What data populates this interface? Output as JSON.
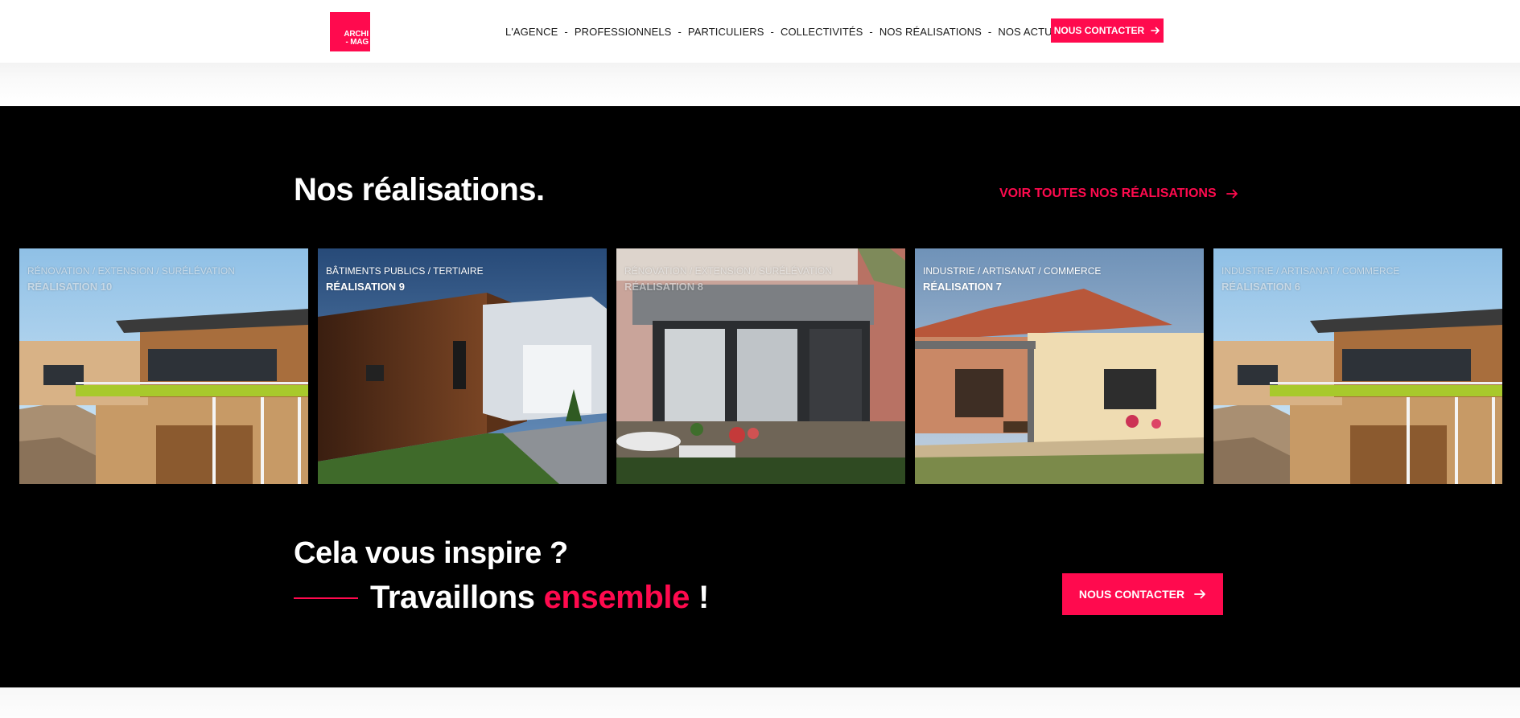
{
  "header": {
    "logo_lines": [
      "ARCHI",
      "- MAG"
    ],
    "nav": [
      {
        "label": "L'AGENCE"
      },
      {
        "label": "PROFESSIONNELS"
      },
      {
        "label": "PARTICULIERS"
      },
      {
        "label": "COLLECTIVITÉS"
      },
      {
        "label": "NOS RÉALISATIONS"
      },
      {
        "label": "NOS ACTUALITÉS"
      }
    ],
    "separator": "-",
    "cta_label": "NOUS CONTACTER",
    "cta_icon": "arrow-right-icon"
  },
  "section": {
    "title": "Nos réalisations.",
    "see_all_label": "VOIR TOUTES NOS RÉALISATIONS",
    "see_all_icon": "arrow-right-icon",
    "cards": [
      {
        "category": "RÉNOVATION / EXTENSION / SURÉLÉVATION",
        "name": "RÉALISATION 10"
      },
      {
        "category": "BÂTIMENTS PUBLICS / TERTIAIRE",
        "name": "RÉALISATION 9"
      },
      {
        "category": "RÉNOVATION / EXTENSION / SURÉLÉVATION",
        "name": "RÉALISATION 8"
      },
      {
        "category": "INDUSTRIE / ARTISANAT / COMMERCE",
        "name": "RÉALISATION 7"
      },
      {
        "category": "INDUSTRIE / ARTISANAT / COMMERCE",
        "name": "RÉALISATION 6"
      }
    ]
  },
  "cta_block": {
    "line1": "Cela vous inspire ?",
    "line2_prefix": "Travaillons",
    "line2_highlight": "ensemble",
    "line2_suffix": "!",
    "button_label": "NOUS CONTACTER",
    "button_icon": "arrow-right-icon"
  },
  "colors": {
    "accent": "#ff0a4e",
    "dark_bg": "#000000",
    "text_light": "#ffffff"
  }
}
